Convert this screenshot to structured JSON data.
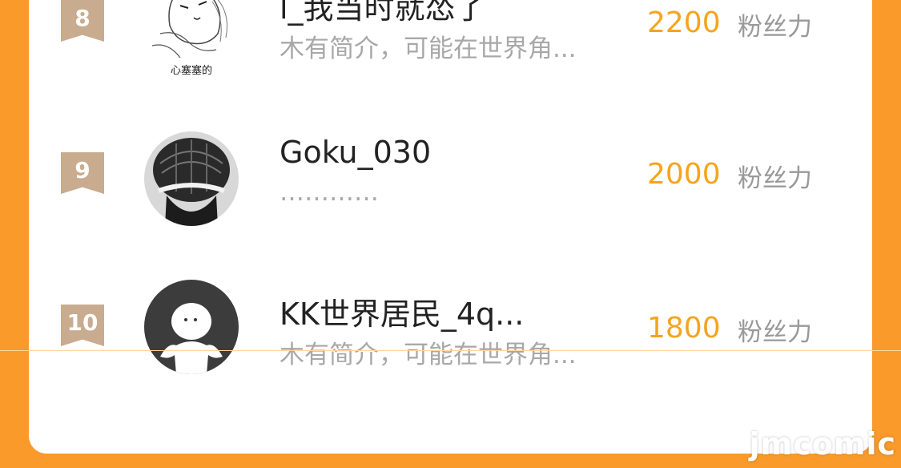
{
  "colors": {
    "background": "#f99a2b",
    "card": "#ffffff",
    "rank_badge": "#c9ab8f",
    "fans_value": "#f5a41d",
    "bio_text": "#a8a8a8"
  },
  "ranking": [
    {
      "rank": "8",
      "username": "l_我当时就怂了",
      "bio": "木有简介，可能在世界角...",
      "fans": "2200",
      "fans_label": "粉丝力",
      "avatar_caption": "心塞塞的"
    },
    {
      "rank": "9",
      "username": "Goku_030",
      "bio": "…………",
      "fans": "2000",
      "fans_label": "粉丝力"
    },
    {
      "rank": "10",
      "username": "KK世界居民_4q...",
      "bio": "木有简介，可能在世界角...",
      "fans": "1800",
      "fans_label": "粉丝力"
    }
  ],
  "watermark": "jmcomic"
}
